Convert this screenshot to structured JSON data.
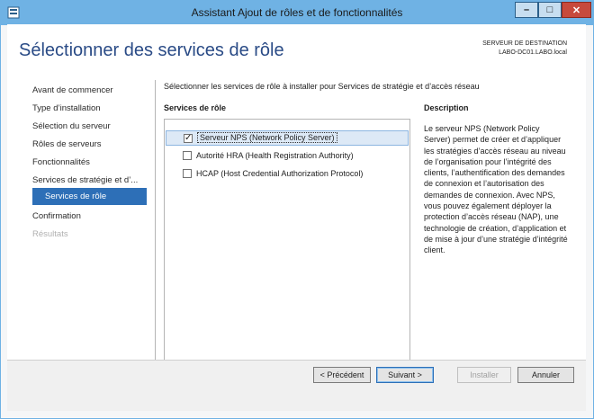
{
  "window": {
    "title": "Assistant Ajout de rôles et de fonctionnalités",
    "min_symbol": "–",
    "max_symbol": "□",
    "close_symbol": "✕",
    "icon": "server-manager-icon"
  },
  "header": {
    "page_title": "Sélectionner des services de rôle",
    "dest_label": "SERVEUR DE DESTINATION",
    "dest_value": "LABO-DC01.LABO.local"
  },
  "nav": {
    "items": [
      {
        "label": "Avant de commencer",
        "state": "normal"
      },
      {
        "label": "Type d’installation",
        "state": "normal"
      },
      {
        "label": "Sélection du serveur",
        "state": "normal"
      },
      {
        "label": "Rôles de serveurs",
        "state": "normal"
      },
      {
        "label": "Fonctionnalités",
        "state": "normal"
      },
      {
        "label": "Services de stratégie et d’...",
        "state": "normal"
      },
      {
        "label": "Services de rôle",
        "state": "active"
      },
      {
        "label": "Confirmation",
        "state": "normal"
      },
      {
        "label": "Résultats",
        "state": "disabled"
      }
    ]
  },
  "main": {
    "instruction": "Sélectionner les services de rôle à installer pour Services de stratégie et d’accès réseau",
    "roles_header": "Services de rôle",
    "description_header": "Description",
    "roles": [
      {
        "label": "Serveur NPS (Network Policy Server)",
        "checked": true,
        "check_symbol": "✓"
      },
      {
        "label": "Autorité HRA (Health Registration Authority)",
        "checked": false,
        "check_symbol": ""
      },
      {
        "label": "HCAP (Host Credential Authorization Protocol)",
        "checked": false,
        "check_symbol": ""
      }
    ],
    "description": "Le serveur NPS (Network Policy Server) permet de créer et d’appliquer les stratégies d’accès réseau au niveau de l’organisation pour l’intégrité des clients, l’authentification des demandes de connexion et l’autorisation des demandes de connexion. Avec NPS, vous pouvez également déployer la protection d’accès réseau (NAP), une technologie de création, d’application et de mise à jour d’une stratégie d’intégrité client."
  },
  "footer": {
    "previous": "< Précédent",
    "next": "Suivant >",
    "install": "Installer",
    "cancel": "Annuler"
  },
  "colors": {
    "title_bar": "#6fb2e4",
    "accent": "#2d6fb7",
    "page_title": "#2a4b86"
  }
}
